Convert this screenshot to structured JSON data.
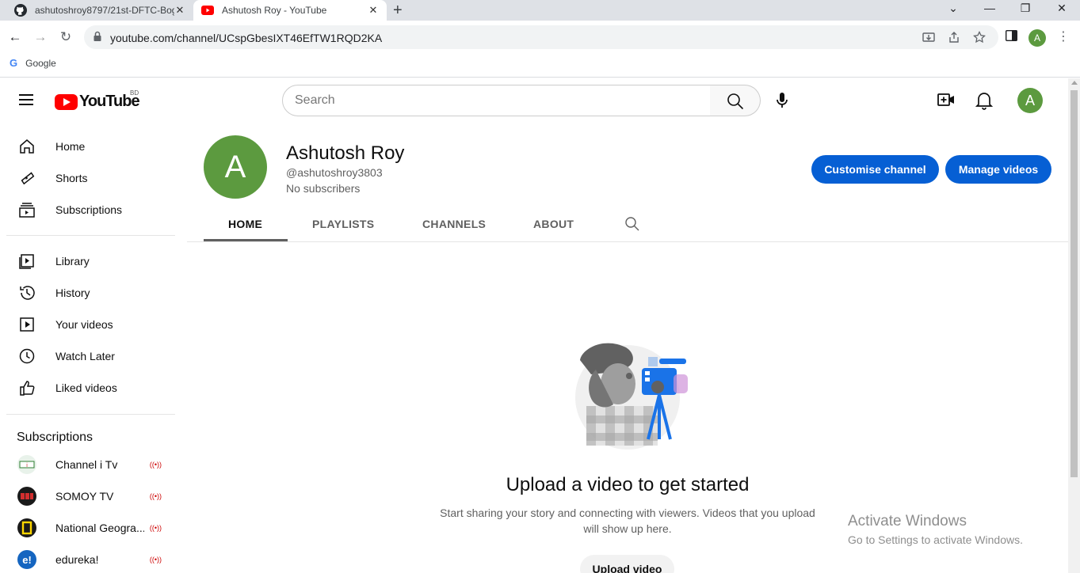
{
  "browser": {
    "tabs": [
      {
        "title": "ashutoshroy8797/21st-DFTC-Bog",
        "icon": "github-icon",
        "active": false
      },
      {
        "title": "Ashutosh Roy - YouTube",
        "icon": "youtube-icon",
        "active": true
      }
    ],
    "url": "youtube.com/channel/UCspGbesIXT46EfTW1RQD2KA",
    "profile_initial": "A",
    "bookmarks": [
      {
        "label": "Google",
        "icon": "google-icon"
      }
    ]
  },
  "youtube": {
    "logo_text": "YouTube",
    "country_code": "BD",
    "search": {
      "placeholder": "Search"
    },
    "user_initial": "A"
  },
  "sidebar": {
    "main": [
      {
        "label": "Home",
        "icon": "home-icon"
      },
      {
        "label": "Shorts",
        "icon": "shorts-icon"
      },
      {
        "label": "Subscriptions",
        "icon": "subscriptions-icon"
      }
    ],
    "library": [
      {
        "label": "Library",
        "icon": "library-icon"
      },
      {
        "label": "History",
        "icon": "history-icon"
      },
      {
        "label": "Your videos",
        "icon": "your-videos-icon"
      },
      {
        "label": "Watch Later",
        "icon": "watch-later-icon"
      },
      {
        "label": "Liked videos",
        "icon": "liked-icon"
      }
    ],
    "subscriptions_heading": "Subscriptions",
    "subscriptions": [
      {
        "name": "Channel i Tv",
        "color": "#e8f2ea"
      },
      {
        "name": "SOMOY TV",
        "color": "#1a1a1a"
      },
      {
        "name": "National Geogra...",
        "color": "#1a1a1a"
      },
      {
        "name": "edureka!",
        "color": "#1565c0"
      }
    ]
  },
  "channel": {
    "avatar_initial": "A",
    "name": "Ashutosh Roy",
    "handle": "@ashutoshroy3803",
    "subscribers": "No subscribers",
    "customise_label": "Customise channel",
    "manage_label": "Manage videos",
    "tabs": [
      "HOME",
      "PLAYLISTS",
      "CHANNELS",
      "ABOUT"
    ],
    "active_tab": "HOME"
  },
  "empty_state": {
    "title": "Upload a video to get started",
    "description": "Start sharing your story and connecting with viewers. Videos that you upload will show up here.",
    "button_label": "Upload video"
  },
  "watermark": {
    "line1": "Activate Windows",
    "line2": "Go to Settings to activate Windows."
  },
  "colors": {
    "accent_blue": "#065fd4",
    "avatar_green": "#5c9a3f",
    "youtube_red": "#ff0000"
  }
}
